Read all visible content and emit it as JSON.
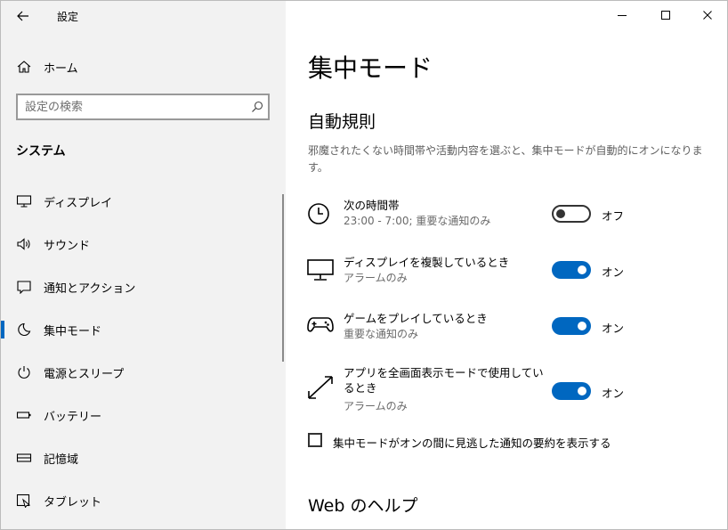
{
  "app": {
    "title": "設定"
  },
  "sidebar": {
    "home_label": "ホーム",
    "search_placeholder": "設定の検索",
    "section": "システム",
    "items": [
      {
        "label": "ディスプレイ",
        "icon": "monitor-icon"
      },
      {
        "label": "サウンド",
        "icon": "speaker-icon"
      },
      {
        "label": "通知とアクション",
        "icon": "notification-icon"
      },
      {
        "label": "集中モード",
        "icon": "moon-icon",
        "active": true
      },
      {
        "label": "電源とスリープ",
        "icon": "power-icon"
      },
      {
        "label": "バッテリー",
        "icon": "battery-icon"
      },
      {
        "label": "記憶域",
        "icon": "storage-icon"
      },
      {
        "label": "タブレット",
        "icon": "tablet-icon"
      }
    ]
  },
  "main": {
    "title": "集中モード",
    "auto_rules_heading": "自動規則",
    "description": "邪魔されたくない時間帯や活動内容を選ぶと、集中モードが自動的にオンになります。",
    "rules": [
      {
        "title": "次の時間帯",
        "subtitle": "23:00 - 7:00; 重要な通知のみ",
        "state": "オフ",
        "on": false,
        "icon": "clock-icon"
      },
      {
        "title": "ディスプレイを複製しているとき",
        "subtitle": "アラームのみ",
        "state": "オン",
        "on": true,
        "icon": "monitor-icon"
      },
      {
        "title": "ゲームをプレイしているとき",
        "subtitle": "重要な通知のみ",
        "state": "オン",
        "on": true,
        "icon": "gamepad-icon"
      },
      {
        "title": "アプリを全画面表示モードで使用しているとき",
        "subtitle": "アラームのみ",
        "state": "オン",
        "on": true,
        "icon": "fullscreen-icon"
      }
    ],
    "summary_checkbox_label": "集中モードがオンの間に見逃した通知の要約を表示する",
    "summary_checked": false,
    "help_heading": "Web のヘルプ"
  },
  "colors": {
    "accent": "#0067c0",
    "sidebar_bg": "#f2f2f2"
  }
}
